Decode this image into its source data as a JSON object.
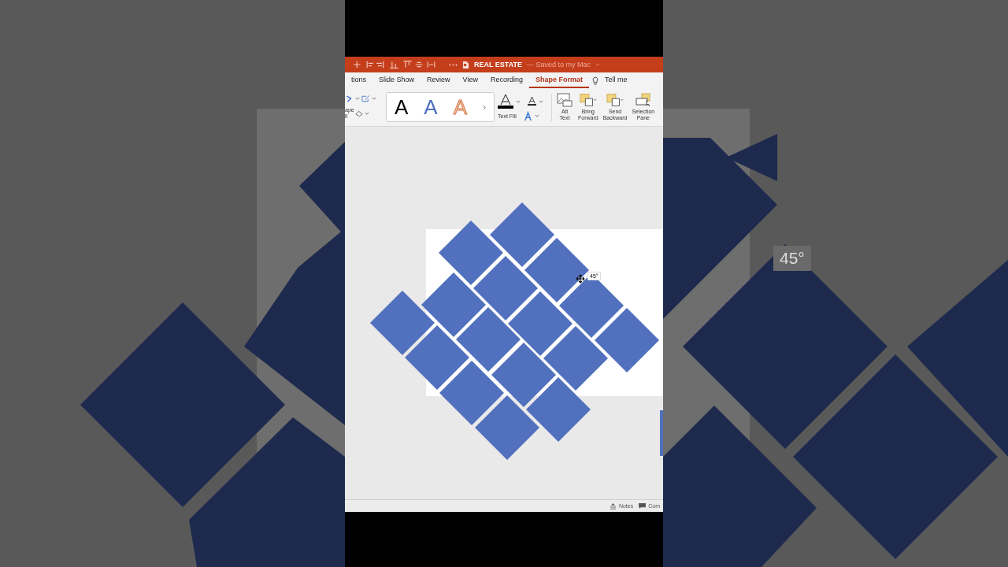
{
  "window": {
    "title": "REAL ESTATE",
    "subtitle": "— Saved to my Mac"
  },
  "tabs": [
    {
      "label": "tions",
      "selected": false
    },
    {
      "label": "Slide Show",
      "selected": false
    },
    {
      "label": "Review",
      "selected": false
    },
    {
      "label": "View",
      "selected": false
    },
    {
      "label": "Recording",
      "selected": false
    },
    {
      "label": "Shape Format",
      "selected": true
    }
  ],
  "tell_me": "Tell me",
  "ribbon": {
    "shape_fill_fragment": [
      "ape",
      "ll"
    ],
    "wordart_letters": [
      "A",
      "A",
      "A"
    ],
    "text_fill": "Text Fill",
    "buttons": [
      {
        "kind": "alt",
        "lines": [
          "Alt",
          "Text"
        ]
      },
      {
        "kind": "forward",
        "lines": [
          "Bring",
          "Forward"
        ]
      },
      {
        "kind": "backward",
        "lines": [
          "Send",
          "Backward"
        ]
      },
      {
        "kind": "pane",
        "lines": [
          "Selection",
          "Pane"
        ]
      }
    ]
  },
  "rotation_tooltip": "45°",
  "status_bar": {
    "notes": "Notes",
    "comments": "Com"
  },
  "backdrop": {
    "tooltip": "45°"
  }
}
